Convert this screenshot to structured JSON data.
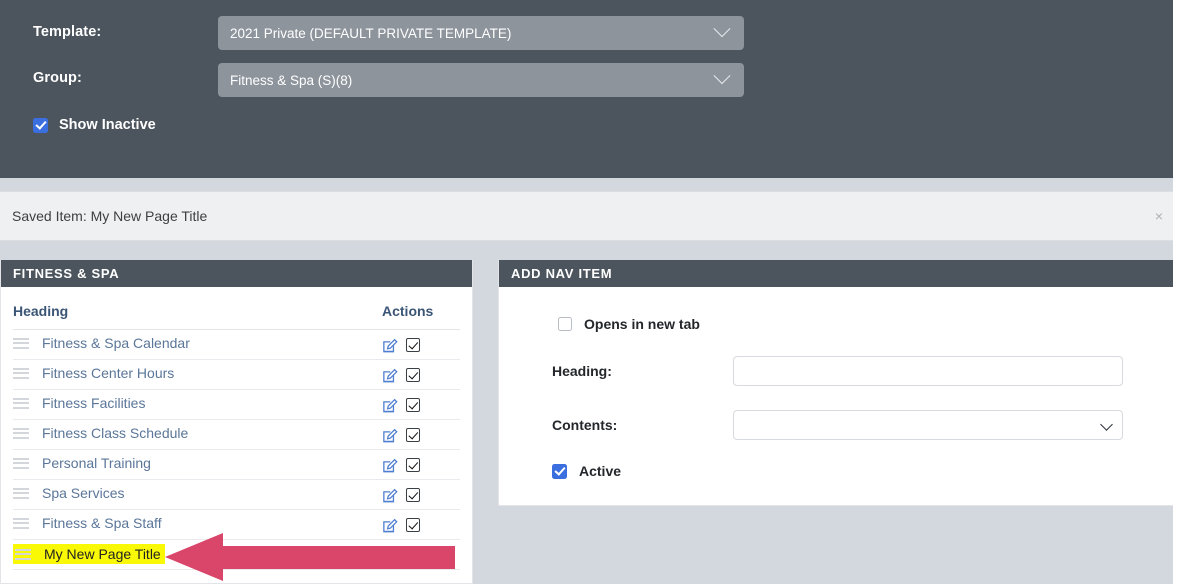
{
  "filters": {
    "template": {
      "label": "Template:",
      "value": "2021 Private (DEFAULT PRIVATE TEMPLATE)"
    },
    "group": {
      "label": "Group:",
      "value": "Fitness & Spa (S)(8)"
    },
    "show_inactive": {
      "label": "Show Inactive",
      "checked": true
    }
  },
  "alert": {
    "message": "Saved Item: My New Page Title",
    "close_label": "×"
  },
  "left_panel": {
    "title": "FITNESS & SPA",
    "columns": {
      "heading": "Heading",
      "actions": "Actions"
    },
    "rows": [
      {
        "label": "Fitness & Spa Calendar",
        "highlighted": false
      },
      {
        "label": "Fitness Center Hours",
        "highlighted": false
      },
      {
        "label": "Fitness Facilities",
        "highlighted": false
      },
      {
        "label": "Fitness Class Schedule",
        "highlighted": false
      },
      {
        "label": "Personal Training",
        "highlighted": false
      },
      {
        "label": "Spa Services",
        "highlighted": false
      },
      {
        "label": "Fitness & Spa Staff",
        "highlighted": false
      },
      {
        "label": "My New Page Title",
        "highlighted": true
      }
    ]
  },
  "right_panel": {
    "title": "ADD NAV ITEM",
    "opens_new_tab": {
      "label": "Opens in new tab",
      "checked": false
    },
    "heading_field": {
      "label": "Heading:",
      "value": "",
      "placeholder": ""
    },
    "contents_field": {
      "label": "Contents:",
      "value": "",
      "selected": ""
    },
    "active": {
      "label": "Active",
      "checked": true
    }
  },
  "colors": {
    "dark_bar": "#4c555e",
    "page_bg": "#d3d7de",
    "select_bg": "#8d949c",
    "link": "#5a7699",
    "checkbox_blue": "#3b6fe0",
    "highlight_yellow": "#f9f906",
    "arrow": "#d9466a",
    "alert_bg": "#eff0f1"
  },
  "icons": {
    "drag_handle": "drag-handle-icon",
    "edit": "edit-pencil-icon",
    "active_checkbox": "checkbox-checked-icon",
    "chevron": "chevron-down-icon",
    "annotation": "left-arrow-annotation"
  }
}
